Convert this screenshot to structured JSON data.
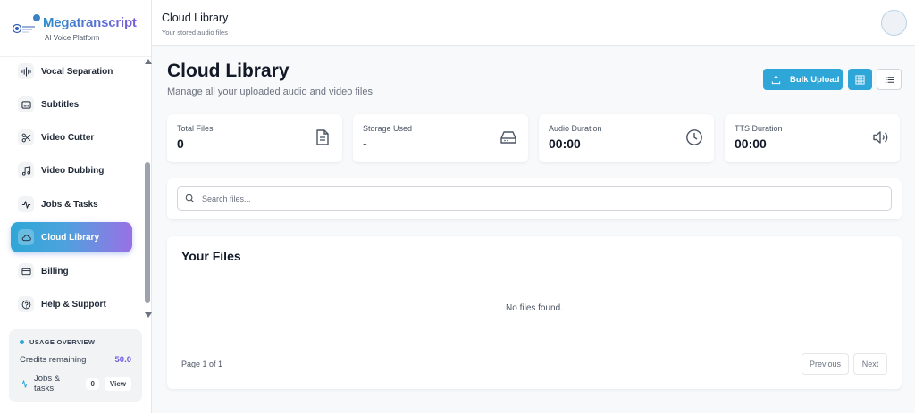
{
  "brand": {
    "name": "Megatranscript",
    "subtitle": "AI Voice Platform"
  },
  "sidebar": {
    "items": [
      {
        "label": "Vocal Separation",
        "icon": "waveform-icon"
      },
      {
        "label": "Subtitles",
        "icon": "subtitles-icon"
      },
      {
        "label": "Video Cutter",
        "icon": "scissors-icon"
      },
      {
        "label": "Video Dubbing",
        "icon": "music-note-icon"
      },
      {
        "label": "Jobs & Tasks",
        "icon": "activity-icon"
      },
      {
        "label": "Cloud Library",
        "icon": "cloud-icon",
        "active": true
      },
      {
        "label": "Billing",
        "icon": "credit-card-icon"
      },
      {
        "label": "Help & Support",
        "icon": "help-circle-icon"
      }
    ],
    "usage": {
      "title": "USAGE OVERVIEW",
      "credits_label": "Credits remaining",
      "credits_value": "50.0",
      "jobs_label": "Jobs & tasks",
      "jobs_count": "0",
      "view_label": "View"
    }
  },
  "header": {
    "title": "Cloud Library",
    "subtitle": "Your stored audio files"
  },
  "main": {
    "title": "Cloud Library",
    "subtitle": "Manage all your uploaded audio and video files",
    "bulk_upload_label": "Bulk Upload",
    "stats": [
      {
        "label": "Total Files",
        "value": "0",
        "icon": "file-text-icon"
      },
      {
        "label": "Storage Used",
        "value": "-",
        "icon": "hard-drive-icon"
      },
      {
        "label": "Audio Duration",
        "value": "00:00",
        "icon": "clock-icon"
      },
      {
        "label": "TTS Duration",
        "value": "00:00",
        "icon": "volume-icon"
      }
    ],
    "search": {
      "placeholder": "Search files...",
      "value": ""
    },
    "files": {
      "title": "Your Files",
      "empty_text": "No files found.",
      "page_info": "Page 1 of 1",
      "previous_label": "Previous",
      "next_label": "Next"
    }
  },
  "colors": {
    "accent": "#2ea6d8",
    "accent_purple": "#9a70e6"
  }
}
